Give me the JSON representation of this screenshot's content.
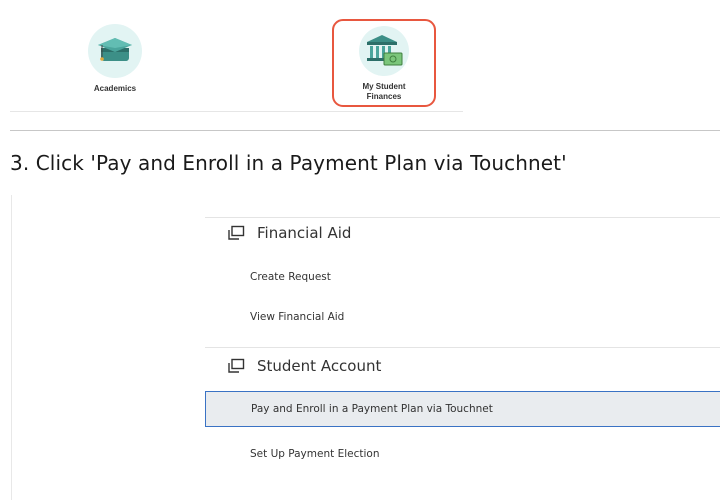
{
  "top_apps": [
    {
      "label": "Academics",
      "icon": "graduation-cap-icon"
    },
    {
      "label": "My Student Finances",
      "icon": "bank-money-icon"
    }
  ],
  "instruction": {
    "text": "3. Click 'Pay and Enroll in a Payment Plan via Touchnet'"
  },
  "menu": {
    "financial_aid": {
      "title": "Financial Aid",
      "icon": "window-stack-icon",
      "links": [
        "Create Request",
        "View Financial Aid"
      ]
    },
    "student_account": {
      "title": "Student Account",
      "icon": "window-stack-icon",
      "links": [
        "Pay and Enroll in a Payment Plan via Touchnet",
        "Set Up Payment Election"
      ]
    }
  },
  "colors": {
    "highlight_border": "#3a72c4",
    "tile_border": "#e8573f",
    "icon_circle": "#e2f4f3"
  }
}
